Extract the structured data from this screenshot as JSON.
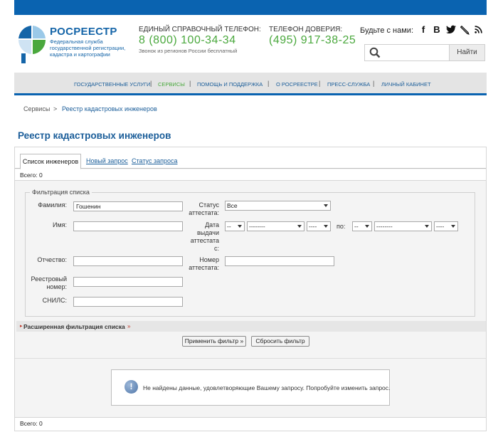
{
  "header": {
    "logo_title": "РОСРЕЕСТР",
    "logo_subtitle": "Федеральная служба государственной регистрации, кадастра и картографии",
    "phone1_label": "ЕДИНЫЙ СПРАВОЧНЫЙ ТЕЛЕФОН:",
    "phone1_number": "8 (800) 100-34-34",
    "phone1_note": "Звонок из регионов России бесплатный",
    "phone2_label": "ТЕЛЕФОН ДОВЕРИЯ:",
    "phone2_number": "(495) 917-38-25",
    "social_label": "Будьте с нами:",
    "social_icons": [
      "facebook-icon",
      "vk-icon",
      "twitter-icon",
      "lj-icon",
      "rss-icon"
    ],
    "search_placeholder": "",
    "search_button": "Найти"
  },
  "nav": {
    "items": [
      {
        "label": "ГОСУДАРСТВЕННЫЕ УСЛУГИ",
        "active": false
      },
      {
        "label": "СЕРВИСЫ",
        "active": true
      },
      {
        "label": "ПОМОЩЬ И ПОДДЕРЖКА",
        "active": false
      },
      {
        "label": "О РОСРЕЕСТРЕ",
        "active": false
      },
      {
        "label": "ПРЕСС-СЛУЖБА",
        "active": false
      },
      {
        "label": "ЛИЧНЫЙ КАБИНЕТ",
        "active": false
      }
    ],
    "separator": "|"
  },
  "breadcrumb": {
    "root": "Сервисы",
    "separator": ">",
    "current": "Реестр кадастровых инженеров"
  },
  "page_title": "Реестр кадастровых инженеров",
  "tabs": [
    "Список инженеров",
    "Новый запрос",
    "Статус запроса"
  ],
  "count_label": "Всего: 0",
  "filter": {
    "legend": "Фильтрация списка",
    "surname_label": "Фамилия:",
    "surname_value": "Гошенин",
    "name_label": "Имя:",
    "name_value": "",
    "patronymic_label": "Отчество:",
    "patronymic_value": "",
    "registry_label": "Реестровый номер:",
    "registry_value": "",
    "snils_label": "СНИЛС:",
    "snils_value": "",
    "status_label": "Статус аттестата:",
    "status_value": "Все",
    "date_label": "Дата выдачи аттестата с:",
    "date_to_label": "по:",
    "day_value": "--",
    "month_value": "--------",
    "year_value": "----",
    "cert_label": "Номер аттестата:",
    "cert_value": ""
  },
  "extended_filter": {
    "label": "Расширенная фильтрация списка",
    "marker_left": "▸",
    "marker_right": "»"
  },
  "buttons": {
    "apply": "Применить фильтр »",
    "reset": "Сбросить фильтр"
  },
  "message": {
    "icon": "info-icon",
    "text": "Не найдены данные, удовлетворяющие Вашему запросу. Попробуйте изменить запрос."
  },
  "colors": {
    "brand_blue": "#0a63b0",
    "link_blue": "#1a5d99",
    "accent_green": "#4aa83d"
  }
}
